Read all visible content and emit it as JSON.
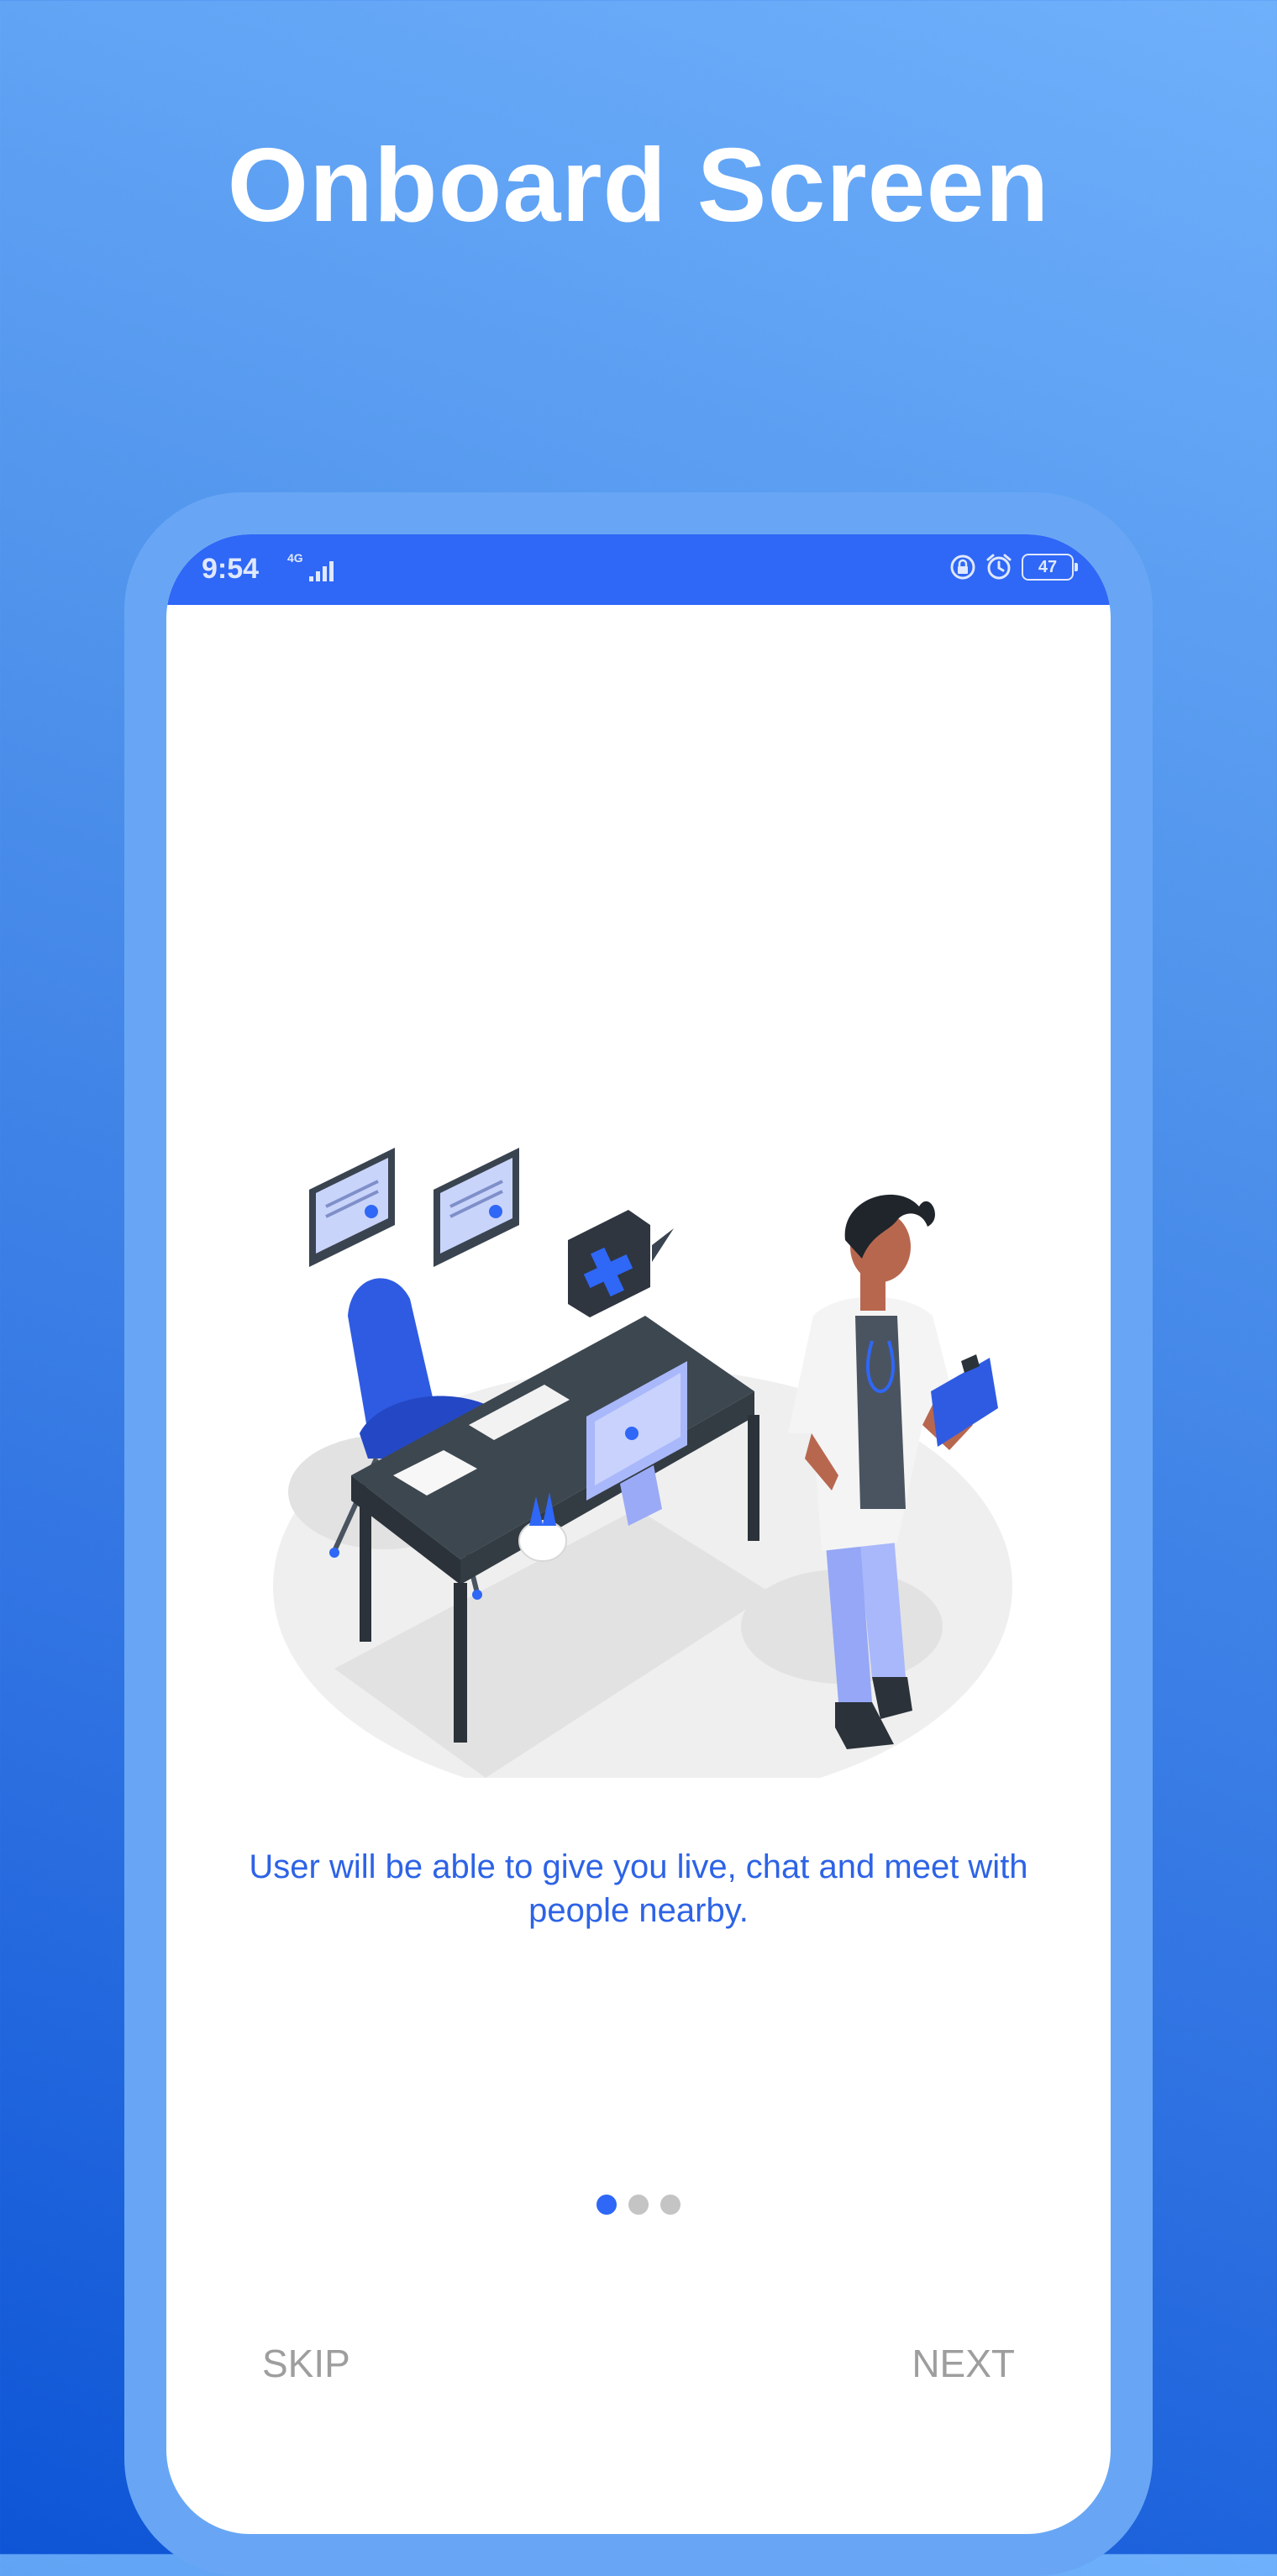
{
  "header": {
    "title": "Onboard Screen"
  },
  "status_bar": {
    "time": "9:54",
    "network": "4G",
    "battery": "47"
  },
  "onboarding": {
    "description": "User will be able to give you live, chat and meet with people nearby.",
    "page_count": 3,
    "active_page": 1,
    "skip_label": "SKIP",
    "next_label": "NEXT"
  },
  "colors": {
    "accent": "#2f67f6",
    "text_blue": "#2d63e6",
    "inactive_button": "#9e9e9e",
    "device_frame": "#68a6f5"
  },
  "icons": [
    "signal-icon",
    "lock-icon",
    "alarm-icon",
    "battery-icon",
    "doctor-illustration"
  ]
}
